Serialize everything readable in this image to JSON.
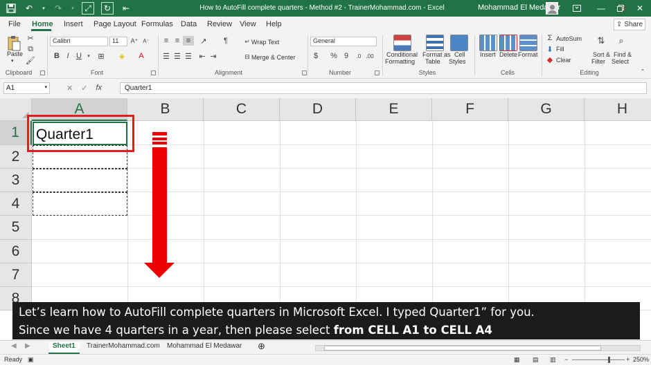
{
  "window": {
    "title": "How to AutoFill complete quarters - Method #2 - TrainerMohammad.com - Excel",
    "user": "Mohammad El Medawar"
  },
  "tabs": [
    "File",
    "Home",
    "Insert",
    "Page Layout",
    "Formulas",
    "Data",
    "Review",
    "View",
    "Help"
  ],
  "share_label": "Share",
  "ribbon": {
    "clipboard": {
      "paste": "Paste",
      "label": "Clipboard"
    },
    "font": {
      "name": "Calibri",
      "size": "11",
      "bold": "B",
      "italic": "I",
      "underline": "U",
      "label": "Font"
    },
    "alignment": {
      "wrap": "Wrap Text",
      "merge": "Merge & Center",
      "label": "Alignment"
    },
    "number": {
      "format": "General",
      "currency": "$",
      "percent": "%",
      "comma": "9",
      "label": "Number"
    },
    "styles": {
      "conditional_1": "Conditional",
      "conditional_2": "Formatting",
      "format_table_1": "Format as",
      "format_table_2": "Table",
      "cell_styles_1": "Cell",
      "cell_styles_2": "Styles",
      "label": "Styles"
    },
    "cells": {
      "insert": "Insert",
      "delete": "Delete",
      "format": "Format",
      "label": "Cells"
    },
    "editing": {
      "autosum": "AutoSum",
      "fill": "Fill",
      "clear": "Clear",
      "sort_1": "Sort &",
      "sort_2": "Filter",
      "find_1": "Find &",
      "find_2": "Select",
      "label": "Editing"
    }
  },
  "formula_bar": {
    "name_box": "A1",
    "fx": "fx",
    "value": "Quarter1"
  },
  "columns": [
    "A",
    "B",
    "C",
    "D",
    "E",
    "F",
    "G",
    "H"
  ],
  "rows": [
    "1",
    "2",
    "3",
    "4",
    "5",
    "6",
    "7",
    "8"
  ],
  "cells": {
    "A1": "Quarter1"
  },
  "caption": {
    "line1": "Let’s learn how to AutoFill complete quarters in Microsoft Excel. I typed Quarter1” for you.",
    "line2_prefix": "Since we have 4 quarters in a year, then please select ",
    "line2_bold": "from CELL A1 to CELL A4"
  },
  "sheets": [
    "Sheet1",
    "TrainerMohammad.com",
    "Mohammad El Medawar"
  ],
  "status": {
    "ready": "Ready",
    "zoom": "250%"
  }
}
